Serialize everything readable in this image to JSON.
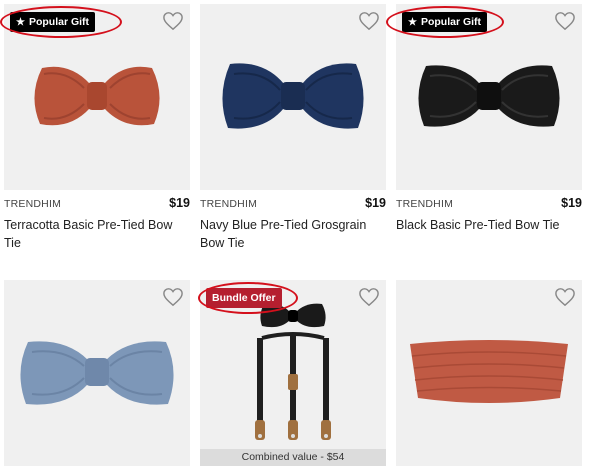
{
  "products": [
    {
      "badge": "Popular Gift",
      "brand": "TRENDHIM",
      "price": "$19",
      "title": "Terracotta Basic Pre-Tied Bow Tie",
      "color": "#b9533a"
    },
    {
      "badge": "",
      "brand": "TRENDHIM",
      "price": "$19",
      "title": "Navy Blue Pre-Tied Grosgrain Bow Tie",
      "color": "#1f3560"
    },
    {
      "badge": "Popular Gift",
      "brand": "TRENDHIM",
      "price": "$19",
      "title": "Black Basic Pre-Tied Bow Tie",
      "color": "#1a1a1a"
    },
    {
      "badge": "",
      "color": "#7d97b8"
    },
    {
      "badge": "Bundle Offer",
      "combined_value": "Combined value - $54",
      "color": "#1a1a1a"
    },
    {
      "badge": "",
      "color": "#c05a44"
    }
  ],
  "icons": {
    "favorite": "heart-outline-icon",
    "badge_star": "star-icon"
  },
  "colors": {
    "badge_black": "#000000",
    "badge_red": "#b51f2f",
    "highlight_ring": "#d4101c"
  }
}
